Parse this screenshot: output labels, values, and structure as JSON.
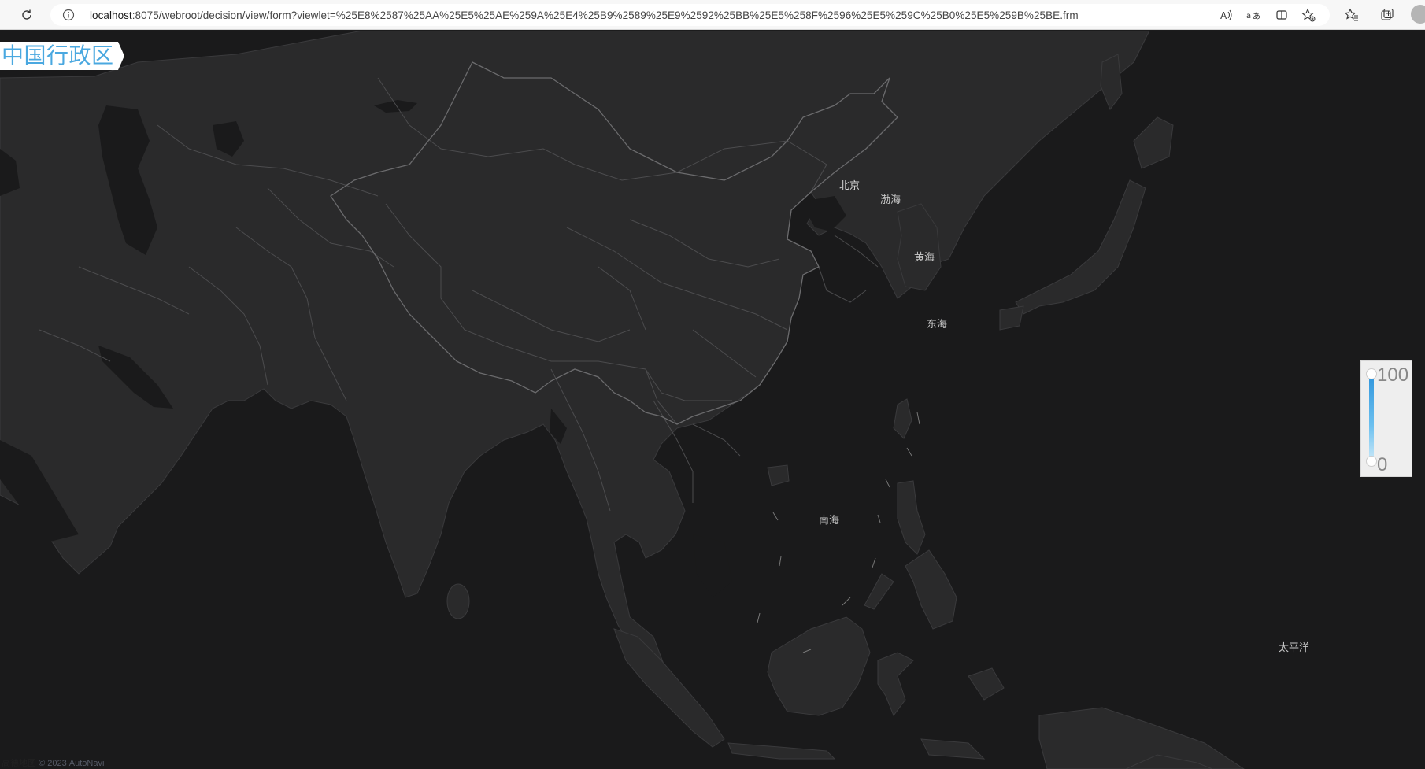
{
  "browser": {
    "url_host": "localhost",
    "url_rest": ":8075/webroot/decision/view/form?viewlet=%25E8%2587%25AA%25E5%25AE%259A%25E4%25B9%2589%25E9%2592%25BB%25E5%258F%2596%25E5%259C%25B0%25E5%259B%25BE.frm"
  },
  "map": {
    "title": "中国行政区",
    "labels": {
      "beijing": "北京",
      "bohai": "渤海",
      "yellow_sea": "黄海",
      "east_sea": "东海",
      "south_sea": "南海",
      "pacific": "太平洋"
    },
    "visual_map": {
      "max_label": "100",
      "min_label": "0",
      "color_high": "#2f95dc",
      "color_low": "#c9e8f8"
    },
    "attribution": {
      "logo_text": "高德地图",
      "copyright": "© 2023 AutoNavi"
    },
    "colors": {
      "land": "#2a2a2b",
      "sea": "#1a1a1b",
      "border": "#5a5a5c",
      "title": "#4aa8e0"
    }
  }
}
